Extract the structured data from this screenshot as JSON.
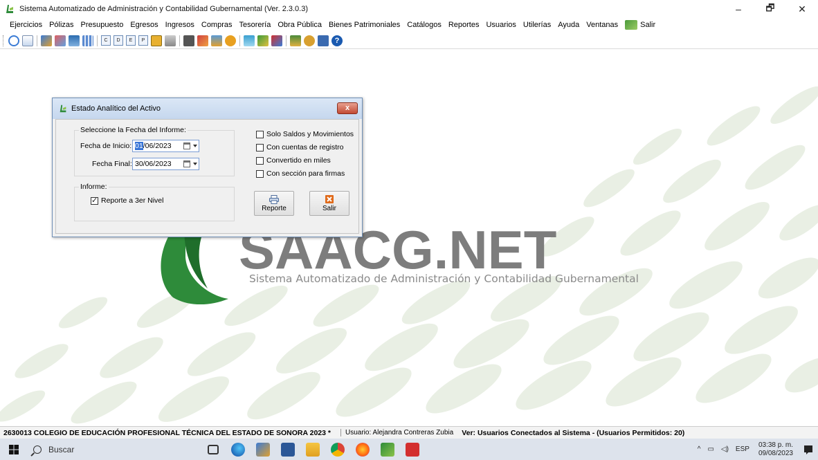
{
  "window": {
    "title": "Sistema Automatizado de Administración y Contabilidad Gubernamental  (Ver. 2.3.0.3)",
    "minimize": "–",
    "maximize": "🗗",
    "close": "✕"
  },
  "menu": {
    "items": [
      "Ejercicios",
      "Pólizas",
      "Presupuesto",
      "Egresos",
      "Ingresos",
      "Compras",
      "Tesorería",
      "Obra Pública",
      "Bienes Patrimoniales",
      "Catálogos",
      "Reportes",
      "Usuarios",
      "Utilerías",
      "Ayuda",
      "Ventanas"
    ],
    "exit_label": "Salir"
  },
  "toolbar": {
    "letters": [
      "C",
      "D",
      "E",
      "P"
    ]
  },
  "watermark": {
    "logo_text": "SAACG.NET",
    "subtitle": "Sistema Automatizado de Administración y Contabilidad Gubernamental"
  },
  "dialog": {
    "title": "Estado Analítico del Activo",
    "close_label": "x",
    "date_group_label": "Seleccione la Fecha del Informe:",
    "start_label": "Fecha de Inicio:",
    "start_value_selected": "01",
    "start_value_rest": "/06/2023",
    "end_label": "Fecha Final:",
    "end_value": "30/06/2023",
    "report_group_label": "Informe:",
    "level_checkbox": "Reporte a 3er Nivel",
    "options": [
      {
        "label": "Solo Saldos y Movimientos",
        "checked": false
      },
      {
        "label": "Con cuentas de registro",
        "checked": false
      },
      {
        "label": "Convertido en miles",
        "checked": false
      },
      {
        "label": "Con sección para firmas",
        "checked": false
      }
    ],
    "report_button": "Reporte",
    "exit_button": "Salir"
  },
  "status": {
    "organization": "2630013 COLEGIO DE EDUCACIÓN PROFESIONAL TÉCNICA DEL ESTADO DE SONORA  2023  *",
    "user": "Usuario: Alejandra Contreras Zubia",
    "connected": "Ver: Usuarios Conectados al Sistema - (Usuarios Permitidos: 20)"
  },
  "taskbar": {
    "search_placeholder": "Buscar",
    "language": "ESP",
    "time": "03:38 p. m.",
    "date": "09/08/2023"
  },
  "colors": {
    "brand_green": "#2e8b3a",
    "brand_gray": "#7d7d7d",
    "accent_blue": "#3875d7"
  }
}
